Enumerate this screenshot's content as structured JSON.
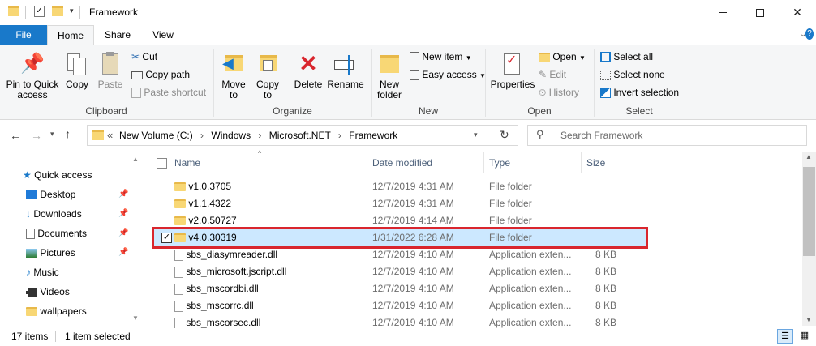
{
  "window": {
    "title": "Framework"
  },
  "tabs": {
    "file": "File",
    "home": "Home",
    "share": "Share",
    "view": "View"
  },
  "ribbon": {
    "clipboard": {
      "label": "Clipboard",
      "pin_l1": "Pin to Quick",
      "pin_l2": "access",
      "copy": "Copy",
      "paste": "Paste",
      "cut": "Cut",
      "copy_path": "Copy path",
      "paste_shortcut": "Paste shortcut"
    },
    "organize": {
      "label": "Organize",
      "move_l1": "Move",
      "move_l2": "to",
      "copy_l1": "Copy",
      "copy_l2": "to",
      "delete": "Delete",
      "rename": "Rename"
    },
    "new": {
      "label": "New",
      "folder_l1": "New",
      "folder_l2": "folder",
      "new_item": "New item",
      "easy_access": "Easy access"
    },
    "open": {
      "label": "Open",
      "properties": "Properties",
      "open": "Open",
      "edit": "Edit",
      "history": "History"
    },
    "select": {
      "label": "Select",
      "select_all": "Select all",
      "select_none": "Select none",
      "invert": "Invert selection"
    }
  },
  "address": {
    "overflow": "«",
    "crumbs": [
      "New Volume (C:)",
      "Windows",
      "Microsoft.NET",
      "Framework"
    ],
    "sep": "›",
    "search_placeholder": "Search Framework"
  },
  "nav": [
    {
      "label": "Quick access",
      "icon": "star-icon"
    },
    {
      "label": "Desktop",
      "icon": "desktop-icon",
      "pinned": true
    },
    {
      "label": "Downloads",
      "icon": "download-icon",
      "pinned": true
    },
    {
      "label": "Documents",
      "icon": "documents-icon",
      "pinned": true
    },
    {
      "label": "Pictures",
      "icon": "pictures-icon",
      "pinned": true
    },
    {
      "label": "Music",
      "icon": "music-icon"
    },
    {
      "label": "Videos",
      "icon": "videos-icon"
    },
    {
      "label": "wallpapers",
      "icon": "folder-icon"
    }
  ],
  "columns": {
    "name": "Name",
    "date": "Date modified",
    "type": "Type",
    "size": "Size"
  },
  "files": [
    {
      "name": "v1.0.3705",
      "date": "12/7/2019 4:31 AM",
      "type": "File folder",
      "size": "",
      "kind": "folder"
    },
    {
      "name": "v1.1.4322",
      "date": "12/7/2019 4:31 AM",
      "type": "File folder",
      "size": "",
      "kind": "folder"
    },
    {
      "name": "v2.0.50727",
      "date": "12/7/2019 4:14 AM",
      "type": "File folder",
      "size": "",
      "kind": "folder"
    },
    {
      "name": "v4.0.30319",
      "date": "1/31/2022 6:28 AM",
      "type": "File folder",
      "size": "",
      "kind": "folder",
      "selected": true
    },
    {
      "name": "sbs_diasymreader.dll",
      "date": "12/7/2019 4:10 AM",
      "type": "Application exten...",
      "size": "8 KB",
      "kind": "dll"
    },
    {
      "name": "sbs_microsoft.jscript.dll",
      "date": "12/7/2019 4:10 AM",
      "type": "Application exten...",
      "size": "8 KB",
      "kind": "dll"
    },
    {
      "name": "sbs_mscordbi.dll",
      "date": "12/7/2019 4:10 AM",
      "type": "Application exten...",
      "size": "8 KB",
      "kind": "dll"
    },
    {
      "name": "sbs_mscorrc.dll",
      "date": "12/7/2019 4:10 AM",
      "type": "Application exten...",
      "size": "8 KB",
      "kind": "dll"
    },
    {
      "name": "sbs_mscorsec.dll",
      "date": "12/7/2019 4:10 AM",
      "type": "Application exten...",
      "size": "8 KB",
      "kind": "dll"
    }
  ],
  "status": {
    "items": "17 items",
    "selected": "1 item selected"
  },
  "colors": {
    "accent": "#1979ca",
    "selection": "#cce8ff",
    "highlight_box": "#d9262e",
    "folder": "#f8d775"
  }
}
